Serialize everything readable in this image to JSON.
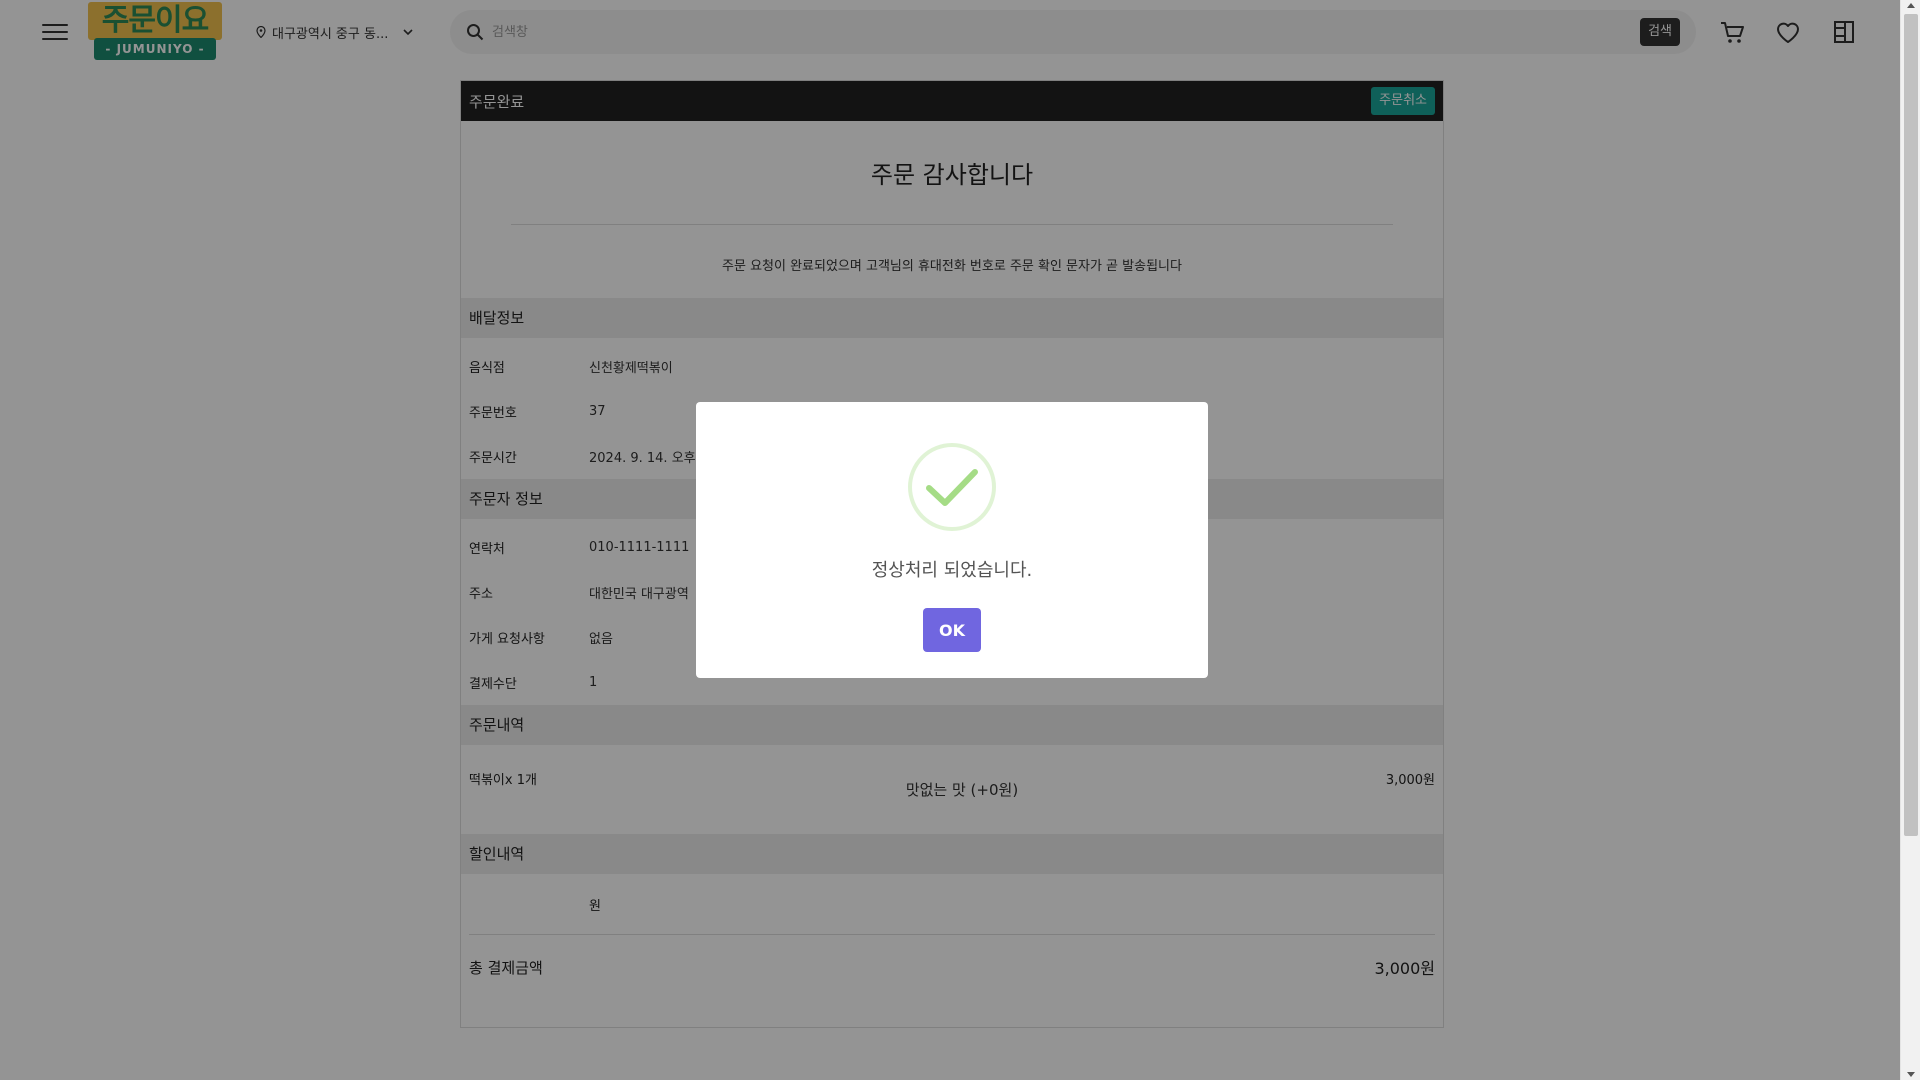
{
  "header": {
    "logo_text_top": "주문이요",
    "logo_text_bottom": "- JUMUNIYO -",
    "location": "대구광역시 중구 동...",
    "search_placeholder": "검색창",
    "search_button": "검색",
    "icons": [
      "menu-icon",
      "location-pin-icon",
      "chevron-down-icon",
      "search-icon",
      "cart-icon",
      "heart-icon",
      "receipt-icon"
    ]
  },
  "order": {
    "header_title": "주문완료",
    "cancel_button": "주문취소",
    "thanks": "주문 감사합니다",
    "notice": "주문 요청이 완료되었으며 고객님의 휴대전화 번호로 주문 확인 문자가 곧 발송됩니다",
    "delivery": {
      "title": "배달정보",
      "rows": [
        {
          "label": "음식점",
          "value": "신천황제떡볶이"
        },
        {
          "label": "주문번호",
          "value": "37"
        },
        {
          "label": "주문시간",
          "value": "2024. 9. 14. 오후"
        }
      ]
    },
    "customer": {
      "title": "주문자 정보",
      "rows": [
        {
          "label": "연락처",
          "value": "010-1111-1111"
        },
        {
          "label": "주소",
          "value": "대한민국 대구광역"
        },
        {
          "label": "가게 요청사항",
          "value": "없음"
        },
        {
          "label": "결제수단",
          "value": "1"
        }
      ]
    },
    "items": {
      "title": "주문내역",
      "list": [
        {
          "name": "떡볶이x 1개",
          "option": "맛없는 맛 (+0원)",
          "price": "3,000원"
        }
      ]
    },
    "discount": {
      "title": "할인내역",
      "value": "원"
    },
    "total": {
      "label": "총 결제금액",
      "amount": "3,000원"
    }
  },
  "modal": {
    "message": "정상처리 되었습니다.",
    "ok_button": "OK",
    "icon": "success-check-icon"
  },
  "colors": {
    "accent_teal": "#1aa69a",
    "modal_button": "#7066e0",
    "success_green": "#a5dc86",
    "header_dark": "#222222"
  }
}
